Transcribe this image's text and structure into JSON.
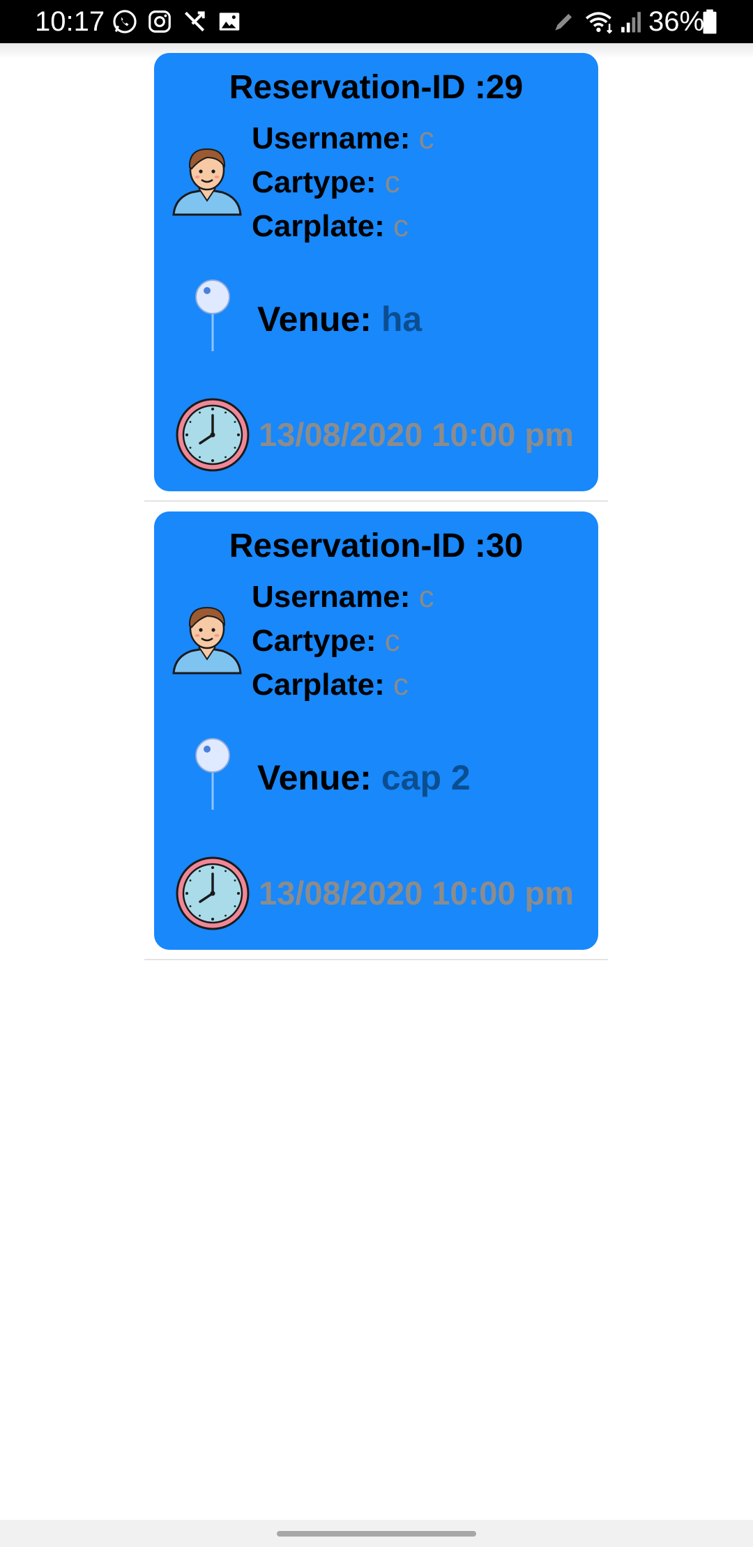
{
  "status_bar": {
    "time": "10:17",
    "battery": "36%",
    "left_icons": [
      "whatsapp-icon",
      "instagram-icon",
      "missed-call-icon",
      "gallery-icon"
    ],
    "right_icons": [
      "edit-icon",
      "wifi-icon",
      "signal-icon",
      "battery-icon"
    ]
  },
  "reservations": [
    {
      "title": "Reservation-ID :29",
      "username_label": "Username:",
      "username": "c",
      "cartype_label": "Cartype:",
      "cartype": "c",
      "carplate_label": "Carplate:",
      "carplate": "c",
      "venue_label": "Venue:",
      "venue": "ha",
      "datetime": "13/08/2020 10:00 pm"
    },
    {
      "title": "Reservation-ID :30",
      "username_label": "Username:",
      "username": "c",
      "cartype_label": "Cartype:",
      "cartype": "c",
      "carplate_label": "Carplate:",
      "carplate": "c",
      "venue_label": "Venue:",
      "venue": "cap 2",
      "datetime": "13/08/2020 10:00 pm"
    }
  ],
  "colors": {
    "card_background": "#1888fb",
    "value_gray": "#8a8a8a",
    "venue_value": "#0b4e90"
  }
}
